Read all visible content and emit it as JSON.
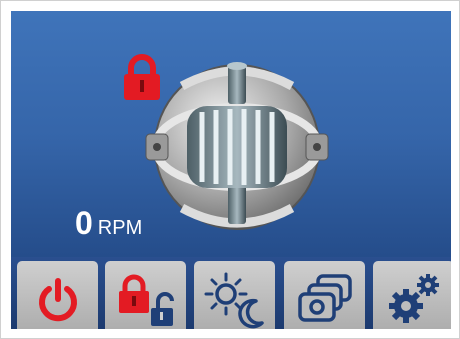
{
  "speed": {
    "value": "0",
    "unit": "RPM"
  },
  "status": {
    "icon": "lock-closed-icon",
    "color": "#e31b23"
  },
  "toolbar": {
    "buttons": [
      {
        "icon": "power-icon",
        "color": "#e31b23"
      },
      {
        "icon": "lock-unlock-icon"
      },
      {
        "icon": "day-night-icon"
      },
      {
        "icon": "programs-icon"
      },
      {
        "icon": "settings-icon"
      }
    ]
  },
  "colors": {
    "background_top": "#3f74ba",
    "background_bottom": "#1b3e78",
    "button": "#bdbdbd",
    "icon_dark": "#1f3f77",
    "alert_red": "#e31b23"
  }
}
